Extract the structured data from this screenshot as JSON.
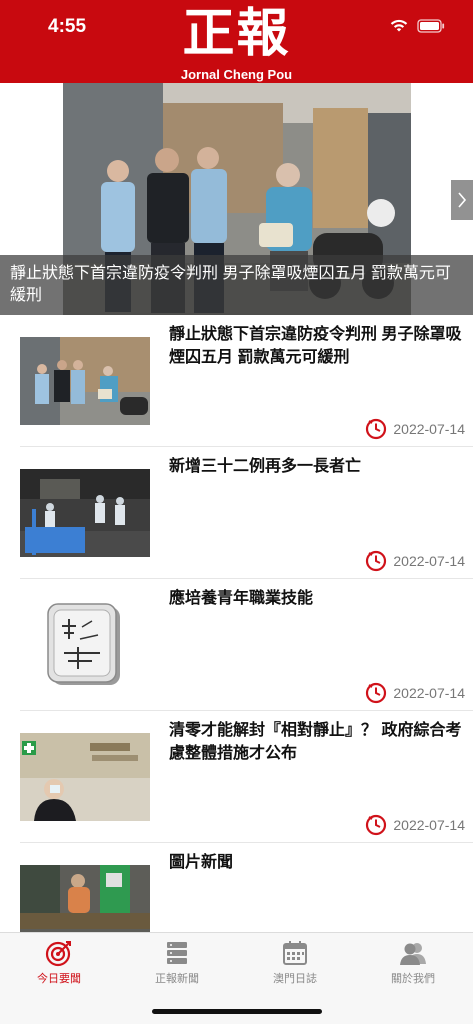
{
  "status_bar": {
    "time": "4:55"
  },
  "header": {
    "logo_main": "正報",
    "logo_sub": "Jornal Cheng Pou",
    "background_color": "#c8090f"
  },
  "hero": {
    "caption": "靜止狀態下首宗違防疫令判刑  男子除罩吸煙囚五月  罰款萬元可緩刑",
    "next_icon": "chevron-right-icon"
  },
  "news": [
    {
      "title": "靜止狀態下首宗違防疫令判刑 男子除罩吸煙囚五月 罰款萬元可緩刑",
      "date": "2022-07-14"
    },
    {
      "title": "新增三十二例再多一長者亡",
      "date": "2022-07-14"
    },
    {
      "title": "應培養青年職業技能",
      "date": "2022-07-14"
    },
    {
      "title": "清零才能解封『相對靜止』？  政府綜合考慮整體措施才公布",
      "date": "2022-07-14"
    },
    {
      "title": "圖片新聞",
      "date": ""
    }
  ],
  "tabs": [
    {
      "label": "今日要聞",
      "icon": "target-icon",
      "active": true
    },
    {
      "label": "正報新聞",
      "icon": "server-icon",
      "active": false
    },
    {
      "label": "澳門日誌",
      "icon": "calendar-icon",
      "active": false
    },
    {
      "label": "關於我們",
      "icon": "people-icon",
      "active": false
    }
  ],
  "colors": {
    "accent": "#d0121a",
    "date_gray": "#777777"
  }
}
